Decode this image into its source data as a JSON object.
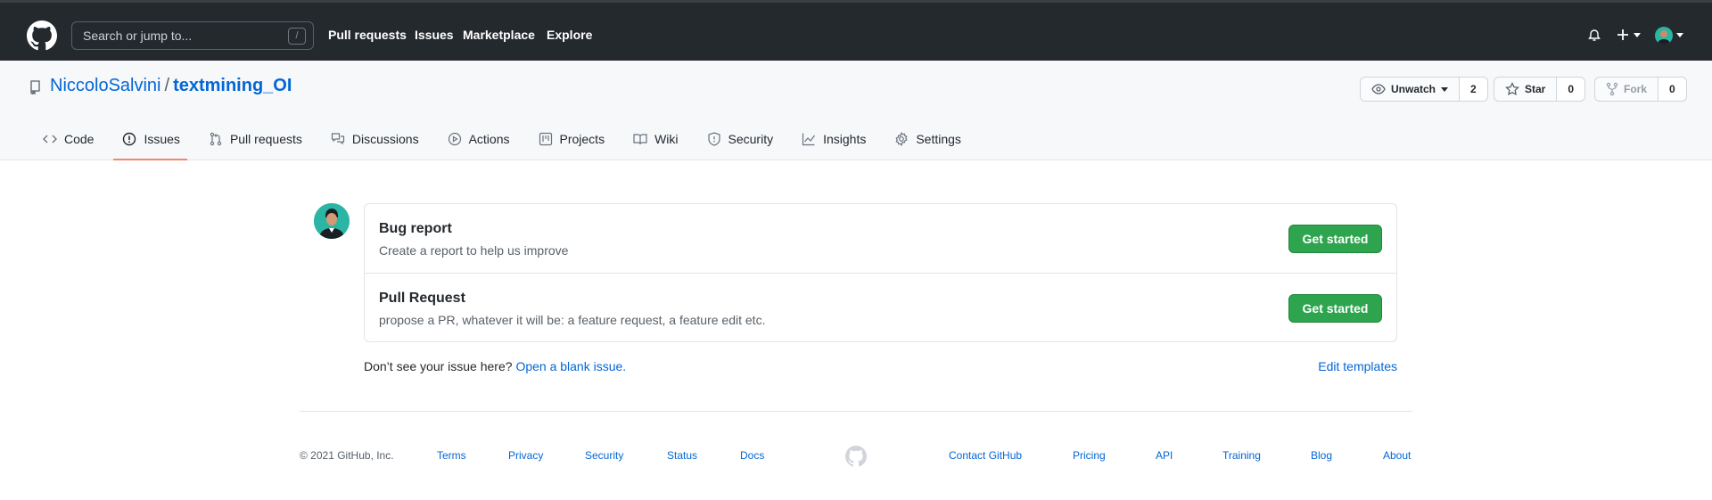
{
  "header": {
    "search_placeholder": "Search or jump to...",
    "search_shortcut": "/",
    "nav": [
      "Pull requests",
      "Issues",
      "Marketplace",
      "Explore"
    ]
  },
  "repo": {
    "owner": "NiccoloSalvini",
    "separator": "/",
    "name": "textmining_OI",
    "watch": {
      "label": "Unwatch",
      "count": "2"
    },
    "star": {
      "label": "Star",
      "count": "0"
    },
    "fork": {
      "label": "Fork",
      "count": "0"
    }
  },
  "tabs": [
    {
      "label": "Code",
      "icon": "code-icon"
    },
    {
      "label": "Issues",
      "icon": "issue-opened-icon",
      "active": true
    },
    {
      "label": "Pull requests",
      "icon": "git-pull-request-icon"
    },
    {
      "label": "Discussions",
      "icon": "comment-discussion-icon"
    },
    {
      "label": "Actions",
      "icon": "play-icon"
    },
    {
      "label": "Projects",
      "icon": "project-icon"
    },
    {
      "label": "Wiki",
      "icon": "book-icon"
    },
    {
      "label": "Security",
      "icon": "shield-icon"
    },
    {
      "label": "Insights",
      "icon": "graph-icon"
    },
    {
      "label": "Settings",
      "icon": "gear-icon"
    }
  ],
  "templates": [
    {
      "title": "Bug report",
      "description": "Create a report to help us improve",
      "button": "Get started"
    },
    {
      "title": "Pull Request",
      "description": "propose a PR, whatever it will be: a feature request, a feature edit etc.",
      "button": "Get started"
    }
  ],
  "blank_issue": {
    "prompt": "Don’t see your issue here?",
    "link": "Open a blank issue.",
    "edit_templates": "Edit templates"
  },
  "footer": {
    "copyright": "© 2021 GitHub, Inc.",
    "left_links": [
      "Terms",
      "Privacy",
      "Security",
      "Status",
      "Docs"
    ],
    "right_links": [
      "Contact GitHub",
      "Pricing",
      "API",
      "Training",
      "Blog",
      "About"
    ]
  },
  "colors": {
    "header_bg": "#24292e",
    "link": "#0366d6",
    "primary_button": "#2ea44f",
    "active_tab_underline": "#f9826c"
  }
}
